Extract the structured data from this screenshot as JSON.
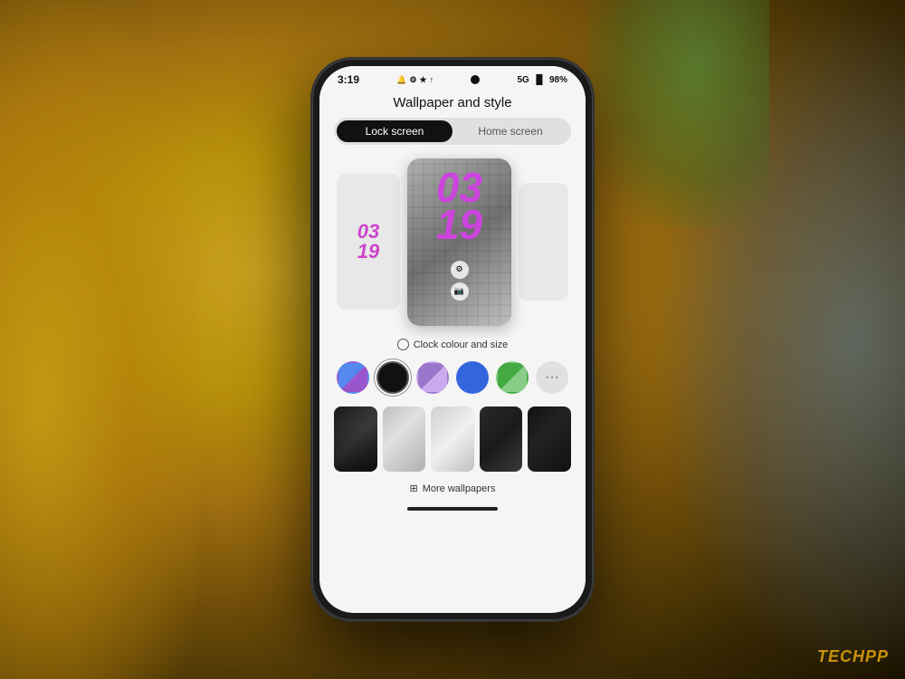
{
  "background": {
    "colors": [
      "#c8a020",
      "#6b4a08",
      "#1a1200"
    ]
  },
  "watermark": {
    "text": "TECHPP",
    "color": "#c8920a"
  },
  "phone": {
    "status_bar": {
      "time": "3:19",
      "signal_icons": "🔔 ⚙ ★ ↑",
      "network": "5G",
      "battery": "98%"
    },
    "screen": {
      "title": "Wallpaper and style",
      "tabs": [
        {
          "label": "Lock screen",
          "active": true
        },
        {
          "label": "Home screen",
          "active": false
        }
      ],
      "preview": {
        "main_time": "03\n19",
        "small_time": "03\n19"
      },
      "clock_settings_label": "Clock colour and size",
      "color_swatches": [
        {
          "id": "split-blue-purple",
          "colors": [
            "#5588ee",
            "#9955cc"
          ],
          "selected": false
        },
        {
          "id": "black",
          "colors": [
            "#111"
          ],
          "selected": true
        },
        {
          "id": "purple-split",
          "colors": [
            "#9977cc",
            "#ccaaee"
          ],
          "selected": false
        },
        {
          "id": "blue",
          "colors": [
            "#3366dd"
          ],
          "selected": false
        },
        {
          "id": "green-split",
          "colors": [
            "#44aa44",
            "#88cc88"
          ],
          "selected": false
        },
        {
          "id": "more",
          "label": "···",
          "selected": false
        }
      ],
      "wallpaper_thumbs": [
        {
          "id": "dark-texture"
        },
        {
          "id": "light-marble"
        },
        {
          "id": "white-floral"
        },
        {
          "id": "dark-stone"
        },
        {
          "id": "black-texture"
        }
      ],
      "more_wallpapers_label": "More wallpapers"
    }
  }
}
